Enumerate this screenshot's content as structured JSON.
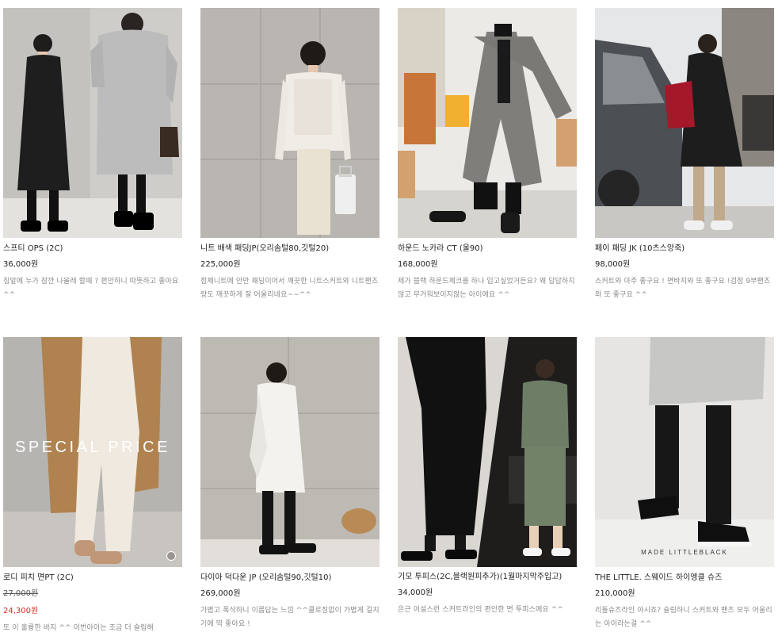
{
  "products": [
    {
      "name": "스프티 OPS (2C)",
      "price": "36,000원",
      "desc": "집앞에 누가 잠깐 나올래 할때 ? 편안하니 따뜻하고 좋아요 ^^"
    },
    {
      "name": "니트 배색 패딩JP(오리솜털80,깃털20)",
      "price": "225,000원",
      "desc": "접체니트에 안만 패딩이어서 깨끗한 니트스커트와 니트팬츠랑도 깨끗하게 잘 어울리네요~~^^"
    },
    {
      "name": "하운드 노카라 CT (울90)",
      "price": "168,000원",
      "desc": "제가 블랙 하운드체크를 하나 입고싶었거든요? 왜 답답하지않고 무거워보이지않는 아이에요 ^^"
    },
    {
      "name": "페이 패딩 JK (10츠스앙죽)",
      "price": "98,000원",
      "desc": "스커트와 아주 좋구요 ! 면바지와 또 좋구요 !검정 9부팬츠와 또 좋구요 ^^"
    },
    {
      "name": "로디 피치 면PT (2C)",
      "orig_price": "27,000원",
      "sale_price": "24,300원",
      "desc": "또 이 훌륭한 바지 ^^ 이번아이는 조금 더 슬림해",
      "overlay": "SPECIAL PRICE"
    },
    {
      "name": "다이아 덕다운 JP (오리솜털90,깃털10)",
      "price": "269,000원",
      "desc": "가볍고 폭삭하니 이름답는 느낌 ^^클로징없이 가볍게 걸치기에 딱 좋아요 !"
    },
    {
      "name": "기모 투피스(2C,블랙원피추가)(1월마지막주입고)",
      "price": "34,000원",
      "desc": "은근 어설스런 스커트라인의 편안한 면 투피스에요 ^^"
    },
    {
      "name": "THE LITTLE. 스웨이드 하이엥클 슈즈",
      "price": "210,000원",
      "desc": "리틀슈즈라인 아시죠? 슬림하니 스커트와 팬츠 모두 어울리는 아이라는걸 ^^",
      "brand": "MADE LITTLEBLACK"
    }
  ],
  "colors": {
    "sale": "#e02828",
    "desc": "#8a8a8a",
    "text": "#222222"
  },
  "icons": {
    "swatch": "color-swatch-dot"
  }
}
